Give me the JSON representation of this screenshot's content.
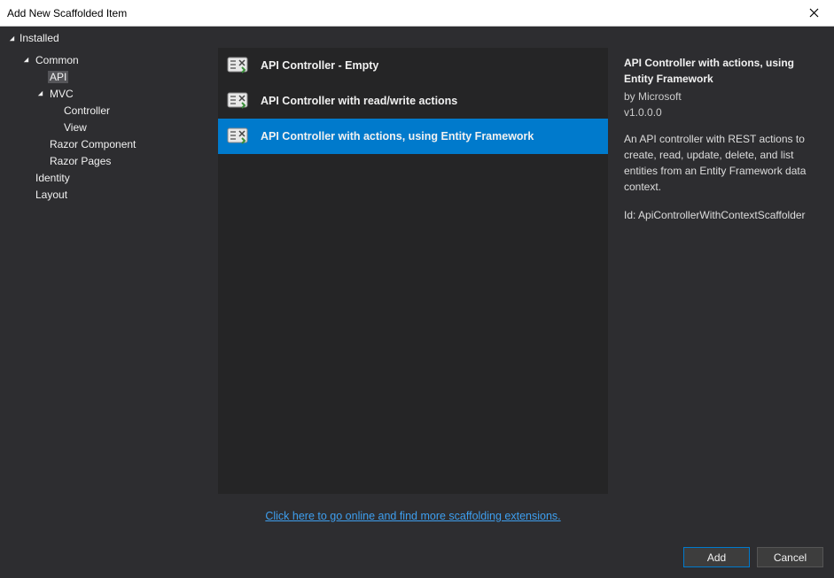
{
  "window": {
    "title": "Add New Scaffolded Item"
  },
  "tree": {
    "root": "Installed",
    "nodes": {
      "common": "Common",
      "api": "API",
      "mvc": "MVC",
      "controller": "Controller",
      "view": "View",
      "razor_component": "Razor Component",
      "razor_pages": "Razor Pages",
      "identity": "Identity",
      "layout": "Layout"
    }
  },
  "templates": [
    {
      "label": "API Controller - Empty"
    },
    {
      "label": "API Controller with read/write actions"
    },
    {
      "label": "API Controller with actions, using Entity Framework"
    }
  ],
  "details": {
    "title": "API Controller with actions, using Entity Framework",
    "author": "by Microsoft",
    "version": "v1.0.0.0",
    "description": "An API controller with REST actions to create, read, update, delete, and list entities from an Entity Framework data context.",
    "id": "Id: ApiControllerWithContextScaffolder"
  },
  "link": "Click here to go online and find more scaffolding extensions.",
  "buttons": {
    "add": "Add",
    "cancel": "Cancel"
  }
}
